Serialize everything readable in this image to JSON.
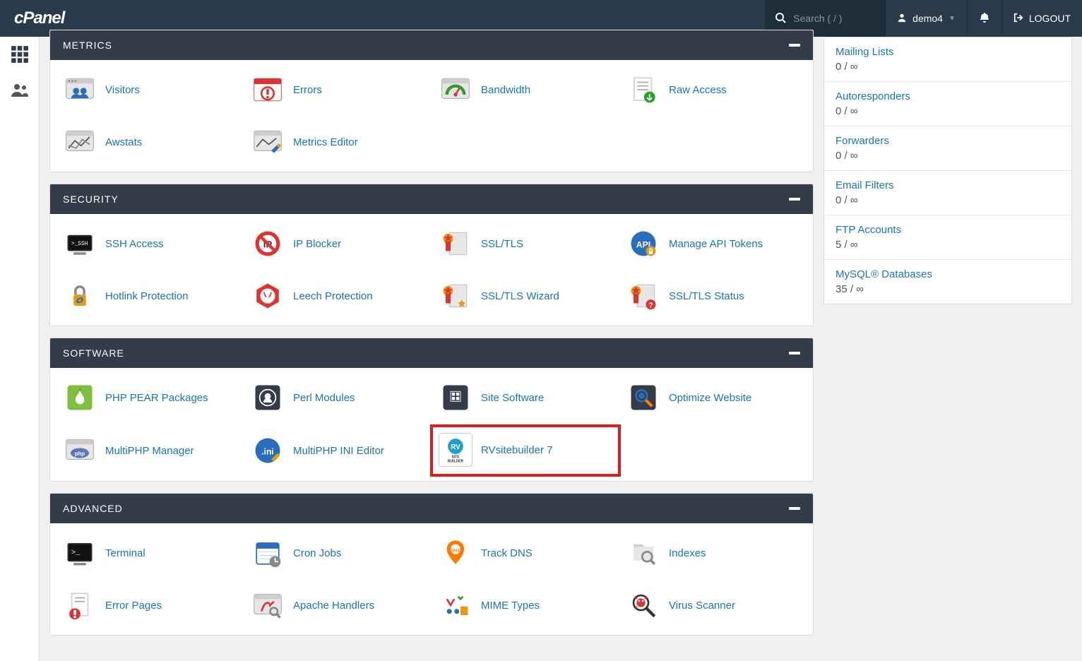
{
  "topbar": {
    "logo_text": "cPanel",
    "search_placeholder": "Search ( / )",
    "user_label": "demo4",
    "logout_label": "LOGOUT"
  },
  "sections": {
    "metrics": {
      "title": "METRICS",
      "items": [
        "Visitors",
        "Errors",
        "Bandwidth",
        "Raw Access",
        "Awstats",
        "Metrics Editor"
      ]
    },
    "security": {
      "title": "SECURITY",
      "items": [
        "SSH Access",
        "IP Blocker",
        "SSL/TLS",
        "Manage API Tokens",
        "Hotlink Protection",
        "Leech Protection",
        "SSL/TLS Wizard",
        "SSL/TLS Status"
      ]
    },
    "software": {
      "title": "SOFTWARE",
      "items": [
        "PHP PEAR Packages",
        "Perl Modules",
        "Site Software",
        "Optimize Website",
        "MultiPHP Manager",
        "MultiPHP INI Editor",
        "RVsitebuilder 7"
      ]
    },
    "advanced": {
      "title": "ADVANCED",
      "items": [
        "Terminal",
        "Cron Jobs",
        "Track DNS",
        "Indexes",
        "Error Pages",
        "Apache Handlers",
        "MIME Types",
        "Virus Scanner"
      ]
    }
  },
  "stats": [
    {
      "label": "Mailing Lists",
      "value": "0 / ∞"
    },
    {
      "label": "Autoresponders",
      "value": "0 / ∞"
    },
    {
      "label": "Forwarders",
      "value": "0 / ∞"
    },
    {
      "label": "Email Filters",
      "value": "0 / ∞"
    },
    {
      "label": "FTP Accounts",
      "value": "5 / ∞"
    },
    {
      "label": "MySQL® Databases",
      "value": "35 / ∞"
    }
  ]
}
